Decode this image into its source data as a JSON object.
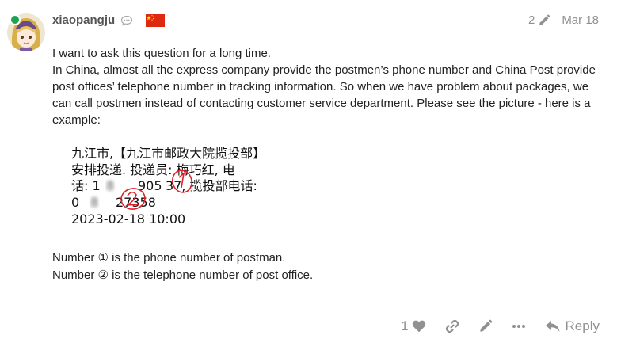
{
  "post": {
    "username": "xiaopangju",
    "flag_country": "China",
    "edit_count": "2",
    "date": "Mar 18",
    "paragraphs": [
      "I want to ask this question for a long time.",
      "In China, almost all the express company provide the postmen’s phone number and China Post provide post offices’ telephone number in tracking information. So when we have problem about packages, we can call postmen instead of contacting customer service department. Please see the picture - here is a example:"
    ],
    "tracking_image": {
      "line1": "九江市,【九江市邮政大院揽投部】",
      "line2": "安排投递. 投递员: 梅巧红, 电",
      "line3_pre": "话: 1",
      "line3_blur": "8",
      "line3_mid": "905",
      "line3_tail": "37, 揽投部电话:",
      "line4_pre": "0",
      "line4_mid": "8",
      "line4_tail": "27358",
      "line5": "2023-02-18 10:00",
      "mark1": "1",
      "mark2": "2"
    },
    "notes": [
      "Number ① is the phone number of postman.",
      "Number ② is the telephone number of post office."
    ],
    "like_count": "1",
    "reply_label": "Reply"
  },
  "icons": {
    "online_status": "online-dot",
    "user_status": "speech-bubble-icon",
    "edit": "pencil-icon",
    "like": "heart-icon",
    "link": "link-icon",
    "edit_post": "pencil-icon",
    "more": "ellipsis-icon",
    "reply": "reply-arrow-icon"
  },
  "colors": {
    "online": "#1ca551",
    "muted": "#919191",
    "annotation": "#e0202a",
    "flag_red": "#de2910",
    "flag_star": "#ffde00"
  }
}
